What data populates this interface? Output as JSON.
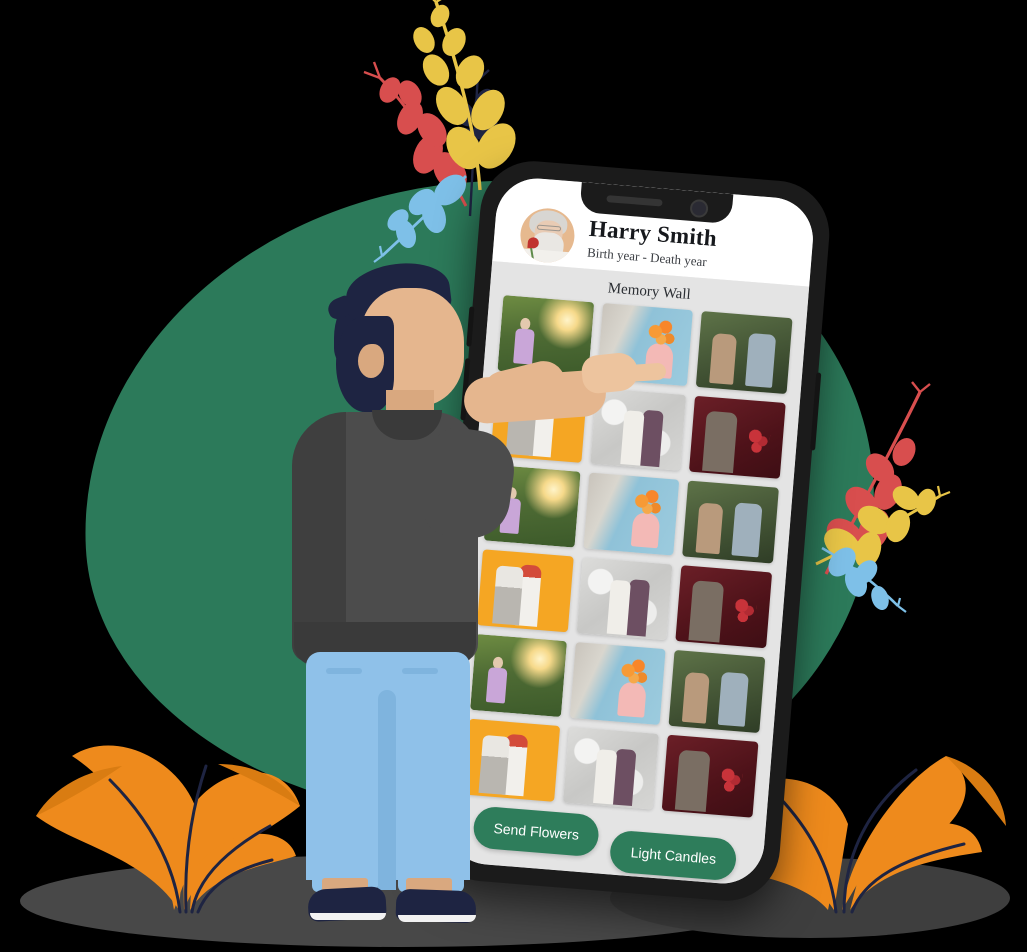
{
  "scene": {
    "title": "Memorial app illustration",
    "colors": {
      "blob_green": "#2C7A5A",
      "brand_green": "#2E7D5B",
      "phone_frame": "#1B1B1B",
      "screen_bg": "#E4E4E4",
      "leaf_orange": "#EE8A1C",
      "leaf_yellow": "#E8C547",
      "leaf_red": "#D84E4E",
      "leaf_blue": "#7EC0E8",
      "leaf_navy": "#1E2442",
      "shadow": "#484848",
      "skin": "#E5B68E",
      "shirt": "#4C4C4C",
      "jeans": "#8FC1E9"
    }
  },
  "phone": {
    "header": {
      "avatar_alt": "Elderly man with white beard holding a red rose",
      "name": "Harry Smith",
      "dates": "Birth year - Death year"
    },
    "wall": {
      "title": "Memory Wall",
      "photos": [
        {
          "alt": "Senior man picking fruit in sunlit garden",
          "theme": "p-garden"
        },
        {
          "alt": "Man hiding orange tulip bouquet behind back",
          "theme": "p-tulip"
        },
        {
          "alt": "Senior couple exchanging flowers outdoors",
          "theme": "p-outdoor"
        },
        {
          "alt": "Happy senior couple with roses on orange backdrop",
          "theme": "p-orange"
        },
        {
          "alt": "Senior couple embracing against grey marble wall",
          "theme": "p-marble"
        },
        {
          "alt": "Bearded man with red tulips on maroon backdrop",
          "theme": "p-maroon"
        },
        {
          "alt": "Senior man picking fruit in sunlit garden",
          "theme": "p-garden"
        },
        {
          "alt": "Man hiding orange tulip bouquet behind back",
          "theme": "p-tulip"
        },
        {
          "alt": "Senior couple exchanging flowers outdoors",
          "theme": "p-outdoor"
        },
        {
          "alt": "Happy senior couple with roses on orange backdrop",
          "theme": "p-orange"
        },
        {
          "alt": "Senior couple embracing against grey marble wall",
          "theme": "p-marble"
        },
        {
          "alt": "Bearded man with red tulips on maroon backdrop",
          "theme": "p-maroon"
        },
        {
          "alt": "Senior man picking fruit in sunlit garden",
          "theme": "p-garden"
        },
        {
          "alt": "Man hiding orange tulip bouquet behind back",
          "theme": "p-tulip"
        },
        {
          "alt": "Senior couple exchanging flowers outdoors",
          "theme": "p-outdoor"
        },
        {
          "alt": "Happy senior couple with roses on orange backdrop",
          "theme": "p-orange"
        },
        {
          "alt": "Senior couple embracing against grey marble wall",
          "theme": "p-marble"
        },
        {
          "alt": "Bearded man with red tulips on maroon backdrop",
          "theme": "p-maroon"
        }
      ]
    },
    "actions": {
      "send_flowers": "Send Flowers",
      "light_candles": "Light Candles"
    },
    "hardware": {
      "power_button": "power-button",
      "volume_up": "volume-up-button",
      "volume_down": "volume-down-button",
      "earpiece": "earpiece-speaker",
      "front_camera": "front-camera"
    }
  },
  "character": {
    "alt": "Man seen from behind pointing at the phone screen"
  },
  "decor": {
    "top_branches_alt": "Decorative yellow, red, navy and blue leaf branches",
    "right_branches_alt": "Decorative red, yellow and blue leaf branches",
    "left_plant_alt": "Orange tropical houseplant",
    "right_plant_alt": "Orange tropical houseplant"
  }
}
